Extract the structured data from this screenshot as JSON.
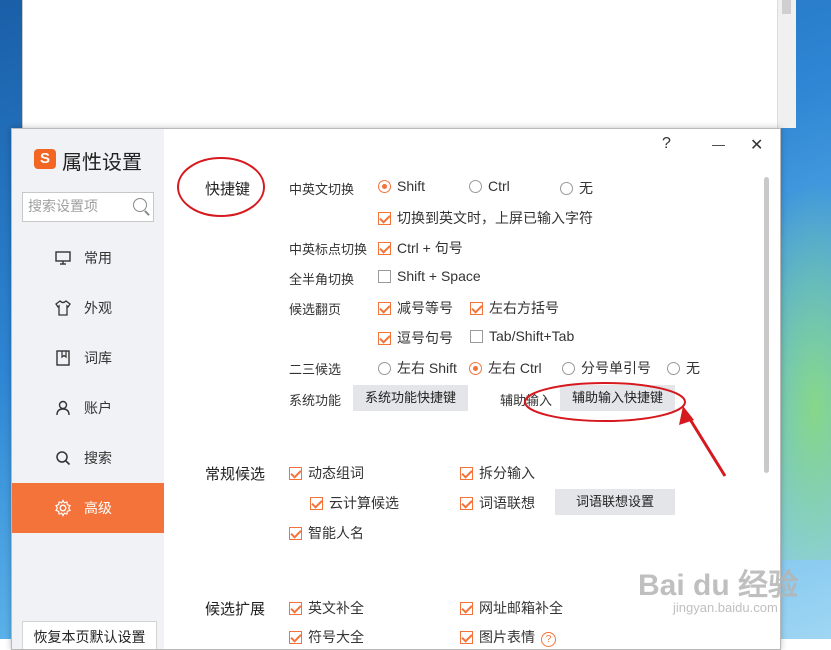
{
  "window": {
    "title": "属性设置",
    "logo": "S",
    "help": "?",
    "minimize": "—",
    "close": "✕"
  },
  "search": {
    "placeholder": "搜索设置项"
  },
  "sidebar": {
    "items": [
      {
        "label": "常用",
        "icon": "monitor-icon"
      },
      {
        "label": "外观",
        "icon": "tshirt-icon"
      },
      {
        "label": "词库",
        "icon": "book-icon"
      },
      {
        "label": "账户",
        "icon": "user-icon"
      },
      {
        "label": "搜索",
        "icon": "search-icon"
      },
      {
        "label": "高级",
        "icon": "gear-icon",
        "active": true
      }
    ],
    "restore_label": "恢复本页默认设置"
  },
  "hotkeys": {
    "title": "快捷键",
    "cn_en_switch": {
      "label": "中英文切换",
      "options": [
        {
          "label": "Shift",
          "selected": true
        },
        {
          "label": "Ctrl",
          "selected": false
        },
        {
          "label": "无",
          "selected": false
        }
      ],
      "commit_on_switch": {
        "label": "切换到英文时，上屏已输入字符",
        "checked": true
      }
    },
    "punct_switch": {
      "label": "中英标点切换",
      "option": {
        "label": "Ctrl + 句号",
        "checked": true
      }
    },
    "fullwidth_switch": {
      "label": "全半角切换",
      "option": {
        "label": "Shift + Space",
        "checked": false
      }
    },
    "page_flip": {
      "label": "候选翻页",
      "options": [
        {
          "label": "减号等号",
          "checked": true
        },
        {
          "label": "左右方括号",
          "checked": true
        },
        {
          "label": "逗号句号",
          "checked": true
        },
        {
          "label": "Tab/Shift+Tab",
          "checked": false
        }
      ]
    },
    "second_third": {
      "label": "二三候选",
      "options": [
        {
          "label": "左右 Shift",
          "selected": false
        },
        {
          "label": "左右 Ctrl",
          "selected": true
        },
        {
          "label": "分号单引号",
          "selected": false
        },
        {
          "label": "无",
          "selected": false
        }
      ]
    },
    "system": {
      "label": "系统功能",
      "button": "系统功能快捷键"
    },
    "assist": {
      "label": "辅助输入",
      "button": "辅助输入快捷键"
    }
  },
  "candidates": {
    "title": "常规候选",
    "options": [
      {
        "label": "动态组词",
        "checked": true
      },
      {
        "label": "拆分输入",
        "checked": true
      },
      {
        "label": "云计算候选",
        "checked": true
      },
      {
        "label": "词语联想",
        "checked": true
      },
      {
        "label": "智能人名",
        "checked": true
      }
    ],
    "assoc_button": "词语联想设置"
  },
  "expansion": {
    "title": "候选扩展",
    "options": [
      {
        "label": "英文补全",
        "checked": true
      },
      {
        "label": "网址邮箱补全",
        "checked": true
      },
      {
        "label": "符号大全",
        "checked": true
      },
      {
        "label": "图片表情",
        "checked": true
      }
    ]
  },
  "watermark": {
    "main": "Bai du 经验",
    "sub": "jingyan.baidu.com"
  },
  "colors": {
    "accent": "#f4733a",
    "annotation": "#d6191f"
  }
}
